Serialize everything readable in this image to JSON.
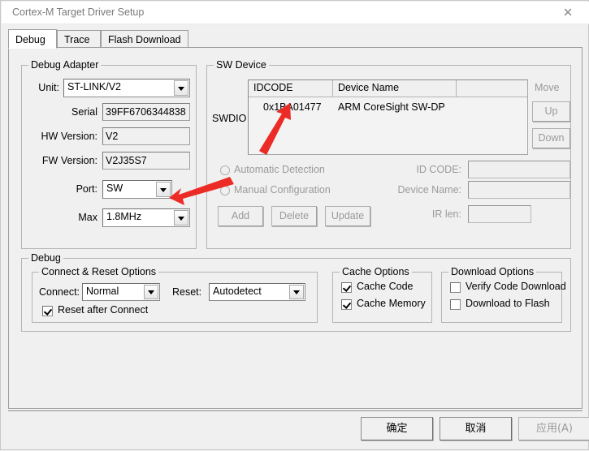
{
  "window": {
    "title": "Cortex-M Target Driver Setup",
    "close_icon": "close-icon",
    "close_glyph": "✕"
  },
  "tabs": [
    {
      "label": "Debug",
      "active": true
    },
    {
      "label": "Trace",
      "active": false
    },
    {
      "label": "Flash Download",
      "active": false
    }
  ],
  "debug_adapter": {
    "legend": "Debug Adapter",
    "unit_label": "Unit:",
    "unit_value": "ST-LINK/V2",
    "serial_label": "Serial",
    "serial_value": "39FF6706344838",
    "hw_version_label": "HW Version:",
    "hw_version_value": "V2",
    "fw_version_label": "FW Version:",
    "fw_version_value": "V2J35S7",
    "port_label": "Port:",
    "port_value": "SW",
    "max_label": "Max",
    "max_value": "1.8MHz"
  },
  "sw_device": {
    "legend": "SW Device",
    "swdio_label": "SWDIO",
    "columns": [
      "IDCODE",
      "Device Name",
      ""
    ],
    "rows": [
      {
        "idcode": "0x1BA01477",
        "device_name": "ARM CoreSight SW-DP"
      }
    ],
    "move_label": "Move",
    "up_label": "Up",
    "down_label": "Down",
    "automatic_detection_label": "Automatic Detection",
    "manual_configuration_label": "Manual Configuration",
    "add_label": "Add",
    "delete_label": "Delete",
    "update_label": "Update",
    "id_code_label": "ID CODE:",
    "id_code_value": "",
    "device_name_label": "Device Name:",
    "device_name_value": "",
    "ir_len_label": "IR len:",
    "ir_len_value": ""
  },
  "debug": {
    "legend": "Debug",
    "connect_reset": {
      "legend": "Connect & Reset Options",
      "connect_label": "Connect:",
      "connect_value": "Normal",
      "reset_label": "Reset:",
      "reset_value": "Autodetect",
      "reset_after_connect_label": "Reset after Connect",
      "reset_after_connect_checked": true
    },
    "cache_options": {
      "legend": "Cache Options",
      "cache_code_label": "Cache Code",
      "cache_code_checked": true,
      "cache_memory_label": "Cache Memory",
      "cache_memory_checked": true
    },
    "download_options": {
      "legend": "Download Options",
      "verify_code_download_label": "Verify Code Download",
      "verify_code_download_checked": false,
      "download_to_flash_label": "Download to Flash",
      "download_to_flash_checked": false
    }
  },
  "footer": {
    "ok_label": "确定",
    "cancel_label": "取消",
    "apply_label": "应用(A)"
  },
  "annotations": {
    "arrow_color": "#ec2b26",
    "arrow_idcode": "arrow-pointing-to-idcode",
    "arrow_port": "arrow-pointing-to-port-dropdown"
  }
}
